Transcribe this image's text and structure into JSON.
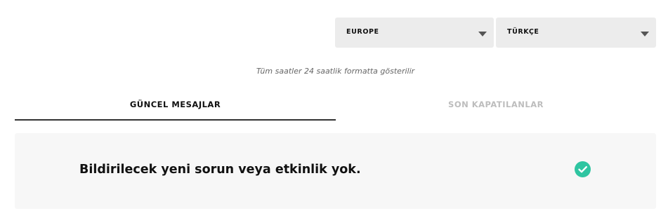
{
  "selectors": {
    "region": {
      "value": "EUROPE",
      "icon": "chevron-down-icon"
    },
    "language": {
      "value": "TÜRKÇE",
      "icon": "chevron-down-icon"
    }
  },
  "time_note": "Tüm saatler 24 saatlik formatta gösterilir",
  "tabs": [
    {
      "label": "GÜNCEL MESAJLAR",
      "active": true
    },
    {
      "label": "SON KAPATILANLAR",
      "active": false
    }
  ],
  "status_panel": {
    "message": "Bildirilecek yeni sorun veya etkinlik yok.",
    "icon": "check-circle-icon",
    "icon_color": "#2fc5a1"
  }
}
